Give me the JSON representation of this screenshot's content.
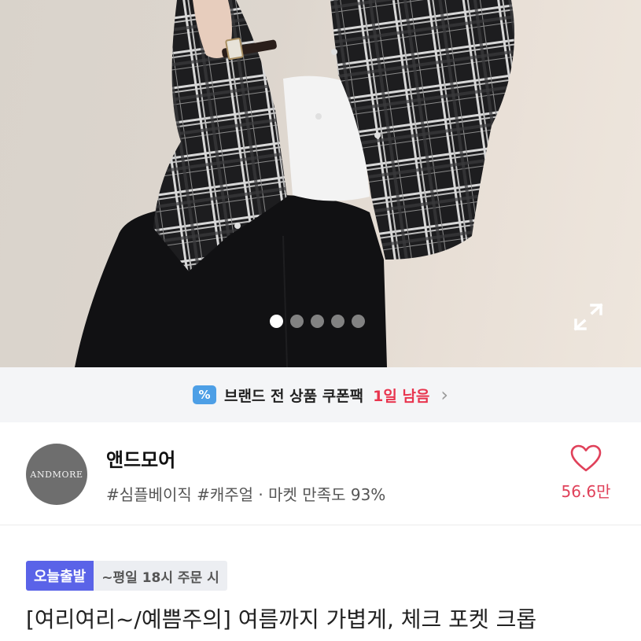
{
  "image": {
    "slide_count": 5,
    "active_slide": 1,
    "expand_icon": "expand-icon"
  },
  "coupon": {
    "icon": "coupon-percent-icon",
    "icon_text": "%",
    "label": "브랜드 전 상품 쿠폰팩",
    "remaining": "1일 남음",
    "chevron": "›"
  },
  "store": {
    "logo_text": "ANDMORE",
    "name": "앤드모어",
    "tags": "#심플베이직 #캐주얼 · 마켓 만족도 93%",
    "like_icon": "heart-icon",
    "like_count": "56.6만"
  },
  "product": {
    "delivery_badge": "오늘출발",
    "delivery_note": "~평일 18시 주문 시",
    "title": "[여리여리~/예쁨주의] 여름까지 가볍게, 체크 포켓 크롭"
  },
  "colors": {
    "accent_red": "#e0415a",
    "coupon_blue": "#4d9fe6",
    "badge_purple": "#5a63e8"
  }
}
